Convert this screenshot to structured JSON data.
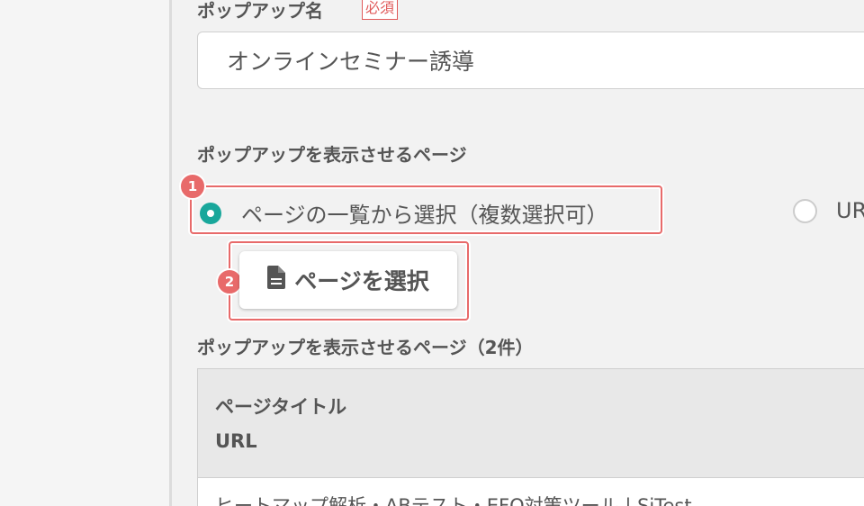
{
  "form": {
    "popup_name_label": "ポップアップ名",
    "required_badge": "必須",
    "popup_name_value": "オンラインセミナー誘導",
    "display_pages_label": "ポップアップを表示させるページ",
    "radio_select_from_list": "ページの一覧から選択（複数選択可）",
    "radio_url": "UR",
    "select_page_button": "ページを選択",
    "pages_list_label": "ポップアップを表示させるページ（2件）"
  },
  "annotations": {
    "badge_1": "1",
    "badge_2": "2"
  },
  "table": {
    "header_title": "ページタイトル",
    "header_url": "URL",
    "rows": [
      {
        "title": "ヒートマップ解析・ABテスト・EFO対策ツール | SiTest"
      }
    ]
  },
  "colors": {
    "accent_teal": "#19a79b",
    "annotation_red": "#e86a6a"
  },
  "icons": {
    "select_page_button_icon": "document-icon"
  }
}
